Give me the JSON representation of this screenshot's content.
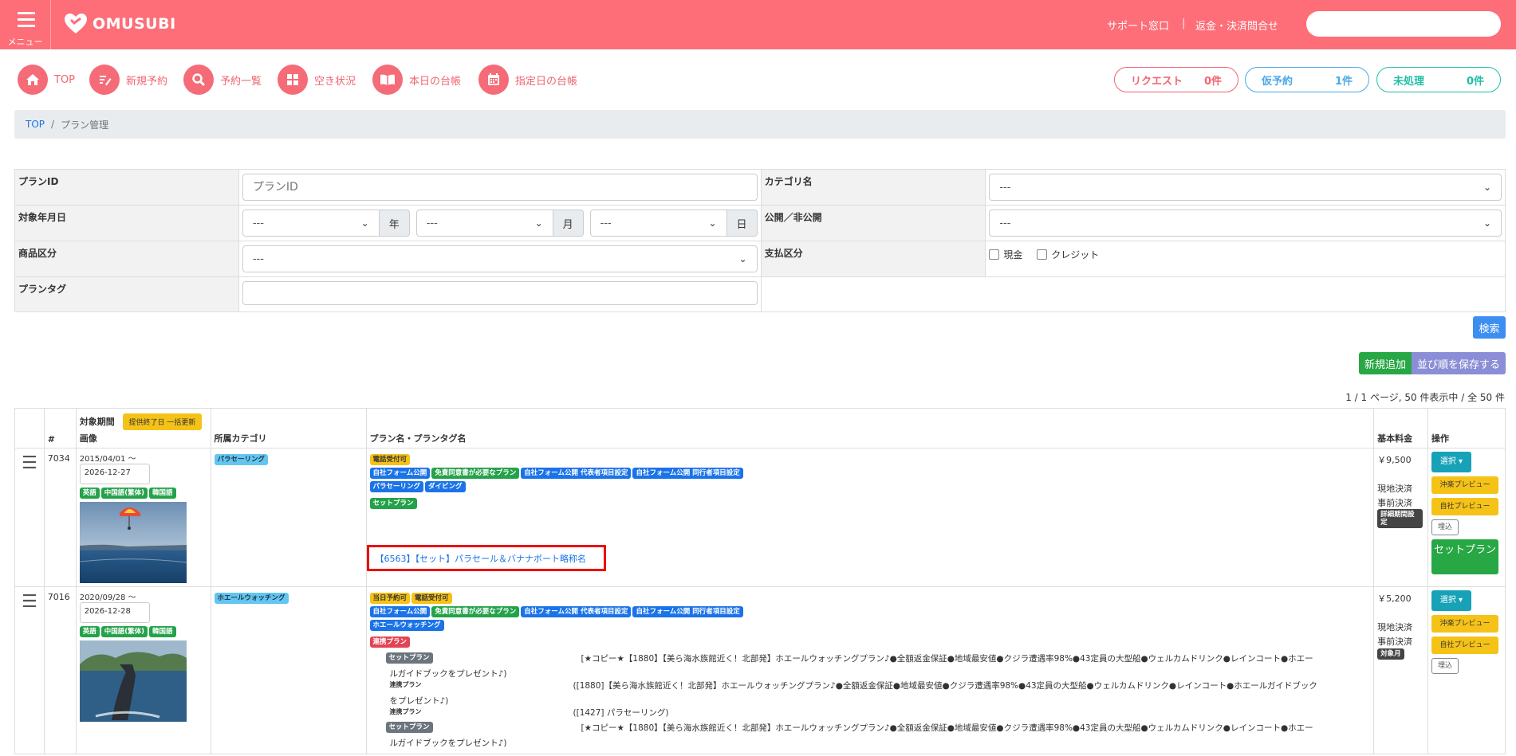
{
  "header": {
    "menu_label": "メニュー",
    "logo_text": "OMUSUBI",
    "support_link": "サポート窓口",
    "separator": "|",
    "refund_link": "返金・決済問合せ",
    "search_placeholder": ""
  },
  "quicknav": [
    {
      "label": "TOP",
      "icon": "home-icon"
    },
    {
      "label": "新規予約",
      "icon": "edit-icon"
    },
    {
      "label": "予約一覧",
      "icon": "search-icon"
    },
    {
      "label": "空き状況",
      "icon": "grid-icon"
    },
    {
      "label": "本日の台帳",
      "icon": "book-icon"
    },
    {
      "label": "指定日の台帳",
      "icon": "calendar-icon"
    }
  ],
  "status_pills": {
    "request": {
      "label": "リクエスト",
      "count": "0件",
      "color": "#f06470"
    },
    "provisional": {
      "label": "仮予約",
      "count": "1件",
      "color": "#4aa8e8"
    },
    "unprocessed": {
      "label": "未処理",
      "count": "0件",
      "color": "#1fbfa6"
    }
  },
  "breadcrumb": {
    "home": "TOP",
    "sep": "/",
    "current": "プラン管理"
  },
  "filters": {
    "plan_id": {
      "label": "プランID",
      "placeholder": "プランID"
    },
    "category": {
      "label": "カテゴリ名",
      "value": "---"
    },
    "target_date": {
      "label": "対象年月日",
      "year": "---",
      "year_unit": "年",
      "month": "---",
      "month_unit": "月",
      "day": "---",
      "day_unit": "日"
    },
    "publish": {
      "label": "公開／非公開",
      "value": "---"
    },
    "product_type": {
      "label": "商品区分",
      "value": "---"
    },
    "payment_type": {
      "label": "支払区分",
      "options": [
        "現金",
        "クレジット"
      ]
    },
    "plan_tag": {
      "label": "プランタグ",
      "value": ""
    }
  },
  "actions": {
    "search": "検索",
    "add_new": "新規追加",
    "save_order": "並び順を保存する"
  },
  "colors": {
    "header": "#fd6e78",
    "search_btn": "#3d8ef0",
    "add_btn": "#28a745",
    "order_btn": "#8b8ed6"
  },
  "pagination": "1 / 1 ページ, 50 件表示中 / 全 50 件",
  "table": {
    "headers": {
      "num": "#",
      "period": "対象期間",
      "period_btn": "提供終了日 一括更新",
      "image": "画像",
      "category": "所属カテゴリ",
      "plan": "プラン名・プランタグ名",
      "price": "基本料金",
      "ops": "操作"
    },
    "rows": [
      {
        "id": "7034",
        "start": "2015/04/01",
        "tilde": "〜",
        "end": "2026-12-27",
        "langs": [
          "英語",
          "中国語(繁体)",
          "韓国語"
        ],
        "category": "パラセーリング",
        "tags1": [
          "電話受付可"
        ],
        "tags2": [
          "自社フォーム公開",
          "免責同意書が必要なプラン",
          "自社フォーム公開 代表者項目設定",
          "自社フォーム公開 同行者項目設定"
        ],
        "tags3": [
          "パラセーリング",
          "ダイビング"
        ],
        "tags4": [
          "セットプラン"
        ],
        "link": "【6563】【セット】パラセール＆バナナボート略称名",
        "price": "￥9,500",
        "pay1": "現地決済",
        "pay2": "事前決済",
        "pay_badge": "詳細期間設定",
        "ops": {
          "select": "選択",
          "preview1": "沖楽プレビュー",
          "preview2": "自社プレビュー",
          "embed": "埋込",
          "set_plan": "セットプラン"
        }
      },
      {
        "id": "7016",
        "start": "2020/09/28",
        "tilde": "〜",
        "end": "2026-12-28",
        "langs": [
          "英語",
          "中国語(繁体)",
          "韓国語"
        ],
        "category": "ホエールウォッチング",
        "tags1": [
          "当日予約可",
          "電話受付可"
        ],
        "tags2": [
          "自社フォーム公開",
          "免責同意書が必要なプラン",
          "自社フォーム公開 代表者項目設定",
          "自社フォーム公開 同行者項目設定"
        ],
        "tags3": [
          "ホエールウォッチング"
        ],
        "tags4": [
          "連携プラン"
        ],
        "sub": [
          {
            "tag": "セットプラン",
            "left": "ルガイドブックをプレゼント♪)",
            "right": "[★コピー★【1880】【美ら海水族館近く！北部発】ホエールウォッチングプラン♪●全額返金保証●地域最安値●クジラ遭遇率98%●43定員の大型船●ウェルカムドリンク●レインコート●ホエー"
          },
          {
            "tag": "連携プラン",
            "left": "をプレゼント♪)",
            "right": "([1880]【美ら海水族館近く！北部発】ホエールウォッチングプラン♪●全額返金保証●地域最安値●クジラ遭遇率98%●43定員の大型船●ウェルカムドリンク●レインコート●ホエールガイドブック"
          },
          {
            "tag": "連携プラン",
            "left": "",
            "right": "([1427] パラセーリング)"
          },
          {
            "tag": "セットプラン",
            "left": "ルガイドブックをプレゼント♪)",
            "right": "[★コピー★【1880】【美ら海水族館近く！北部発】ホエールウォッチングプラン♪●全額返金保証●地域最安値●クジラ遭遇率98%●43定員の大型船●ウェルカムドリンク●レインコート●ホエー"
          }
        ],
        "price": "￥5,200",
        "pay1": "現地決済",
        "pay2": "事前決済",
        "pay_badge": "対象月",
        "ops": {
          "select": "選択",
          "preview1": "沖楽プレビュー",
          "preview2": "自社プレビュー",
          "embed": "埋込"
        }
      }
    ]
  }
}
